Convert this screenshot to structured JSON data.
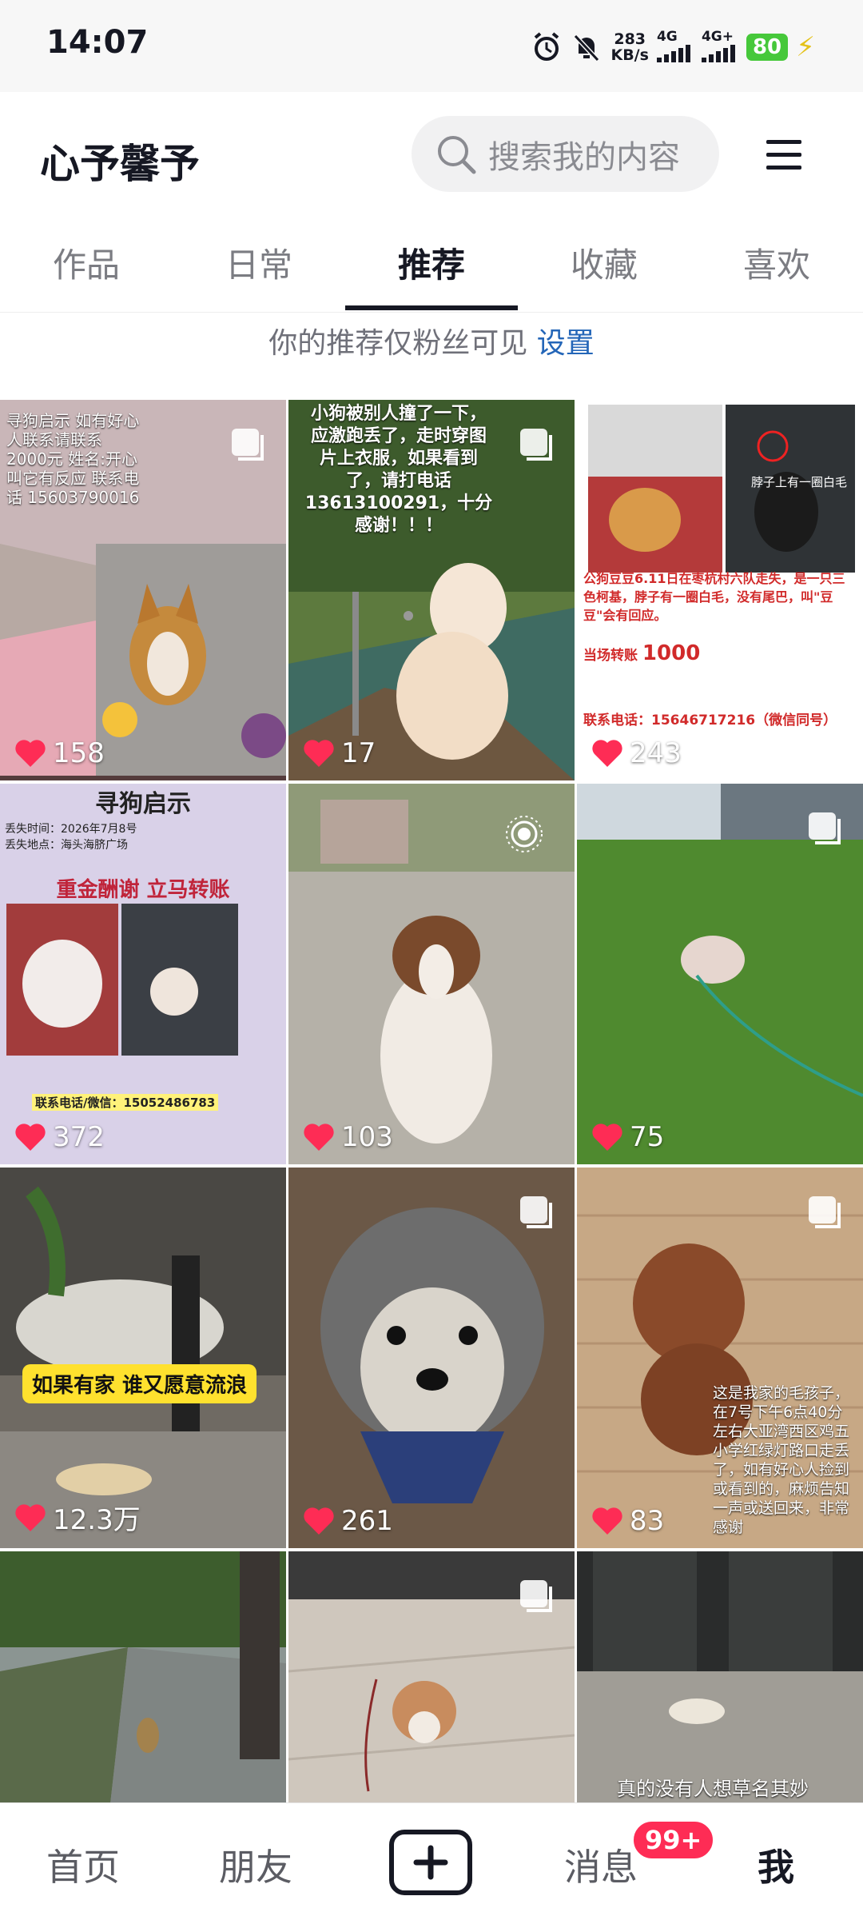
{
  "status_bar": {
    "time": "14:07",
    "net_speed_value": "283",
    "net_speed_unit": "KB/s",
    "signal1": "4G",
    "signal2": "4G+",
    "battery": "80"
  },
  "header": {
    "username": "心予馨予",
    "search_placeholder": "搜索我的内容"
  },
  "tabs": [
    {
      "label": "作品",
      "active": false
    },
    {
      "label": "日常",
      "active": false
    },
    {
      "label": "推荐",
      "active": true
    },
    {
      "label": "收藏",
      "active": false
    },
    {
      "label": "喜欢",
      "active": false
    }
  ],
  "notice": {
    "text": "你的推荐仅粉丝可见",
    "link": "设置"
  },
  "grid": [
    {
      "likes": "158",
      "overlay": "寻狗启示 如有好心人联系请联系 2000元 姓名:开心 叫它有反应 联系电话 15603790016"
    },
    {
      "likes": "17",
      "overlay": "小狗被别人撞了一下，应激跑丢了，走时穿图片上衣服，如果看到了，请打电话13613100291，十分感谢！！！"
    },
    {
      "likes": "243",
      "overlay": "公狗豆豆6.11日在枣杭村六队走失，是一只三色柯基，脖子有一圈白毛，没有尾巴，叫\"豆豆\"会有回应。",
      "overlay2": "联系电话：15646717216（微信同号）",
      "sub_label": "脖子上有一圈白毛",
      "reward_text": "当场转账",
      "reward_amount": "1000"
    },
    {
      "likes": "372",
      "title": "寻狗启示",
      "headline": "重金酬谢 立马转账",
      "lost_time": "丢失时间：2026年7月8号",
      "lost_place": "丢失地点：海头海脐广场",
      "contact": "联系电话/微信：15052486783"
    },
    {
      "likes": "103"
    },
    {
      "likes": "75"
    },
    {
      "likes": "12.3万",
      "banner": "如果有家 谁又愿意流浪"
    },
    {
      "likes": "261"
    },
    {
      "likes": "83",
      "overlay": "这是我家的毛孩子，在7号下午6点40分左右大亚湾西区鸡五小学红绿灯路口走丢了，如有好心人捡到或看到的，麻烦告知一声或送回来，非常感谢"
    },
    {
      "likes": ""
    },
    {
      "likes": ""
    },
    {
      "likes": "",
      "overlay": "真的没有人想草名其妙"
    }
  ],
  "bottom_nav": {
    "home": "首页",
    "friends": "朋友",
    "messages": "消息",
    "me": "我",
    "badge": "99+"
  },
  "colors": {
    "accent": "#fe2c55",
    "link": "#2466b8",
    "text": "#161823"
  }
}
